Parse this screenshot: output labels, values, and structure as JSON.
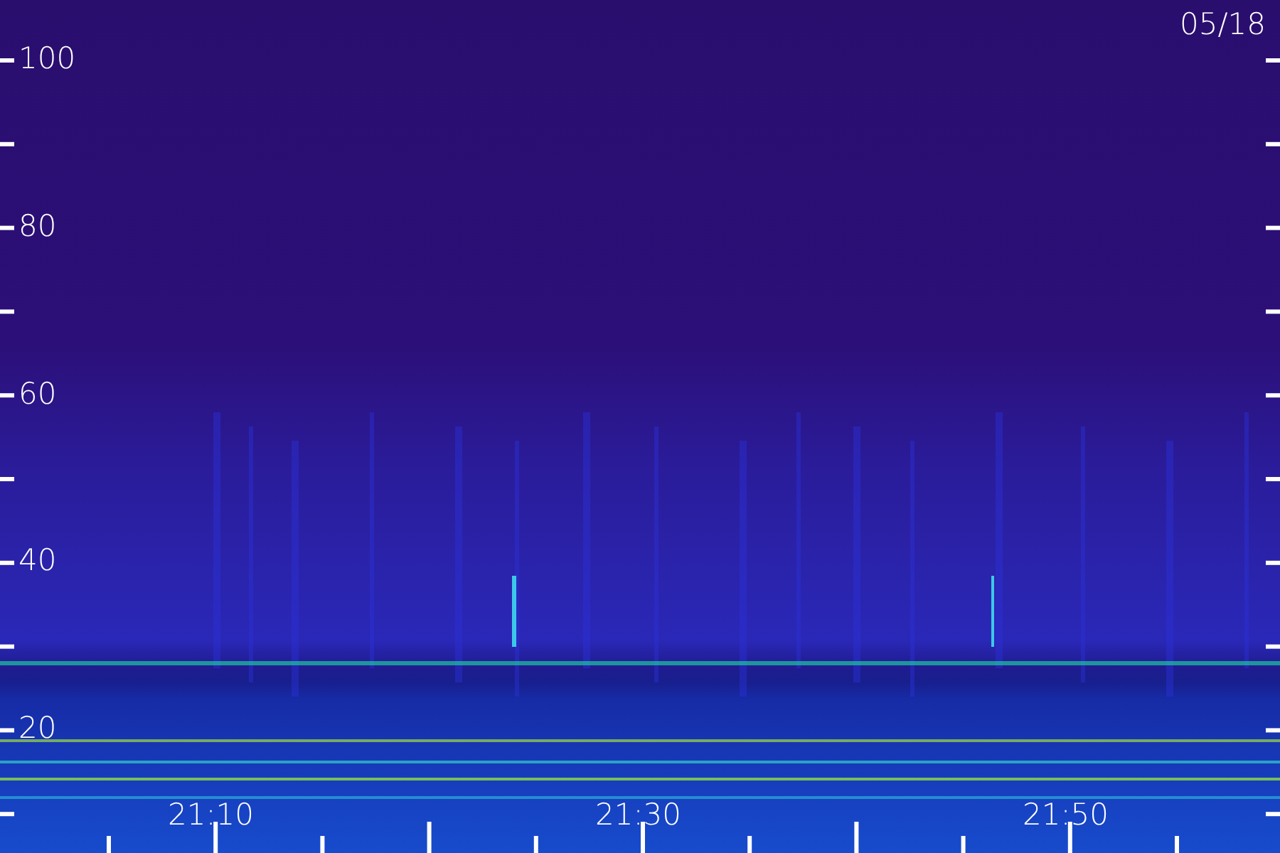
{
  "date": "05/18",
  "y_axis": {
    "labels": [
      "100",
      "80",
      "60",
      "40",
      "20"
    ]
  },
  "x_axis": {
    "labels": [
      "21:10",
      "21:30",
      "21:50"
    ]
  }
}
